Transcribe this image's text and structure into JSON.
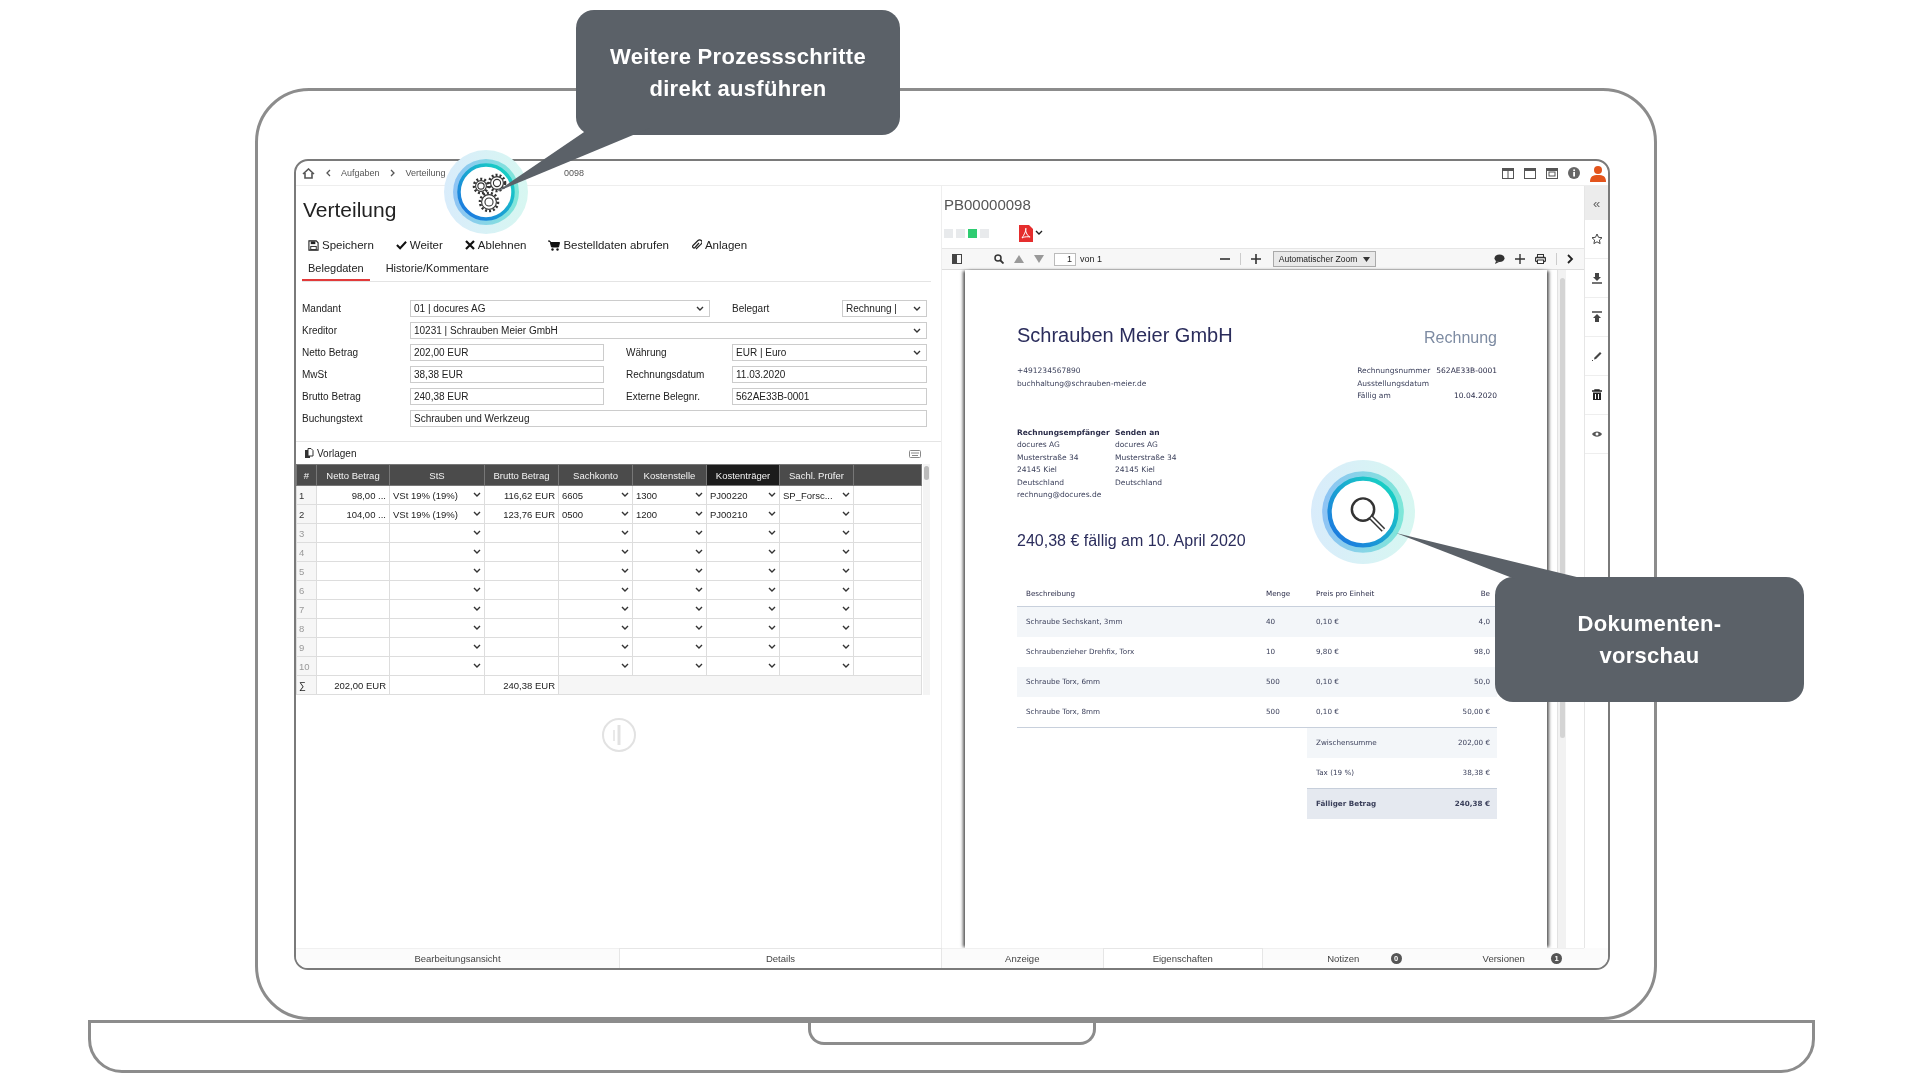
{
  "callouts": [
    {
      "lines": [
        "Weitere Prozessschritte",
        "direkt ausführen"
      ]
    },
    {
      "lines": [
        "Dokumenten-",
        "vorschau"
      ]
    }
  ],
  "breadcrumb": [
    "Aufgaben",
    "Verteilung",
    "0098"
  ],
  "left": {
    "title": "Verteilung",
    "toolbar": [
      "Speichern",
      "Weiter",
      "Ablehnen",
      "Bestelldaten abrufen",
      "Anlagen"
    ],
    "tabs": [
      {
        "label": "Belegdaten",
        "selected": true
      },
      {
        "label": "Historie/Kommentare",
        "selected": false
      }
    ],
    "form": [
      {
        "fields": [
          {
            "label": "Mandant",
            "kind": "select",
            "value": "01 | docures AG"
          },
          {
            "label": "Belegart",
            "kind": "select",
            "value": "Rechnung |"
          }
        ]
      },
      {
        "fields": [
          {
            "label": "Kreditor",
            "kind": "select",
            "value": "10231 | Schrauben Meier GmbH"
          }
        ]
      },
      {
        "fields": [
          {
            "label": "Netto Betrag",
            "kind": "text",
            "value": "202,00 EUR"
          },
          {
            "label": "Währung",
            "kind": "select",
            "value": "EUR | Euro"
          }
        ]
      },
      {
        "fields": [
          {
            "label": "MwSt",
            "kind": "text",
            "value": "38,38 EUR"
          },
          {
            "label": "Rechnungsdatum",
            "kind": "text",
            "value": "11.03.2020"
          }
        ]
      },
      {
        "fields": [
          {
            "label": "Brutto Betrag",
            "kind": "text",
            "value": "240,38 EUR"
          },
          {
            "label": "Externe Belegnr.",
            "kind": "text",
            "value": "562AE33B-0001"
          }
        ]
      },
      {
        "fields": [
          {
            "label": "Buchungstext",
            "kind": "text",
            "value": "Schrauben und Werkzeug"
          }
        ]
      }
    ],
    "templates_label": "Vorlagen",
    "table": {
      "number_header": "#",
      "columns": [
        {
          "label": "Netto Betrag",
          "kind": "text",
          "selected": false
        },
        {
          "label": "StS",
          "kind": "select",
          "selected": false
        },
        {
          "label": "Brutto Betrag",
          "kind": "text",
          "selected": false
        },
        {
          "label": "Sachkonto",
          "kind": "select",
          "selected": false
        },
        {
          "label": "Kostenstelle",
          "kind": "select",
          "selected": false
        },
        {
          "label": "Kostenträger",
          "kind": "select",
          "selected": true
        },
        {
          "label": "Sachl. Prüfer",
          "kind": "select",
          "selected": false
        }
      ],
      "rows": [
        {
          "number": "1",
          "cells": [
            "98,00 ...",
            "VSt 19% (19%)",
            "116,62 EUR",
            "6605",
            "1300",
            "PJ00220",
            "SP_Forsc..."
          ]
        },
        {
          "number": "2",
          "cells": [
            "104,00 ...",
            "VSt 19% (19%)",
            "123,76 EUR",
            "0500",
            "1200",
            "PJ00210"
          ]
        },
        {
          "number": "3"
        },
        {
          "number": "4"
        },
        {
          "number": "5"
        },
        {
          "number": "6"
        },
        {
          "number": "7"
        },
        {
          "number": "8"
        },
        {
          "number": "9"
        },
        {
          "number": "10"
        }
      ],
      "sum": {
        "symbol": "∑",
        "netto": "202,00 EUR",
        "brutto": "240,38 EUR"
      }
    }
  },
  "doc": {
    "document_id": "PB00000098",
    "status_steps": [
      {
        "active": false
      },
      {
        "active": false
      },
      {
        "active": true
      },
      {
        "active": false
      }
    ],
    "page": "1",
    "page_total": "von 1",
    "zoom": "Automatischer Zoom",
    "invoice": {
      "company": "Schrauben Meier GmbH",
      "doc_type": "Rechnung",
      "contact": [
        "+491234567890",
        "buchhaltung@schrauben-meier.de"
      ],
      "meta": [
        {
          "label": "Rechnungsnummer",
          "value": "562AE33B-0001"
        },
        {
          "label": "Ausstellungsdatum"
        },
        {
          "label": "Fällig am",
          "value": "10.04.2020"
        }
      ],
      "addresses": [
        {
          "heading": "Rechnungsempfänger",
          "lines": [
            "docures AG",
            "Musterstraße 34",
            "24145 Kiel",
            "Deutschland",
            "rechnung@docures.de"
          ]
        },
        {
          "heading": "Senden an",
          "lines": [
            "docures AG",
            "Musterstraße 34",
            "24145 Kiel",
            "Deutschland"
          ]
        }
      ],
      "due_line": "240,38 € fällig am 10. April 2020",
      "columns": [
        "Beschreibung",
        "Menge",
        "Preis pro Einheit",
        "Be"
      ],
      "items": [
        {
          "description": "Schraube Sechskant, 3mm",
          "quantity": "40",
          "unit_price": "0,10 €",
          "amount": "4,0"
        },
        {
          "description": "Schraubenzieher Drehfix, Torx",
          "quantity": "10",
          "unit_price": "9,80 €",
          "amount": "98,0"
        },
        {
          "description": "Schraube Torx, 6mm",
          "quantity": "500",
          "unit_price": "0,10 €",
          "amount": "50,0"
        },
        {
          "description": "Schraube Torx, 8mm",
          "quantity": "500",
          "unit_price": "0,10 €",
          "amount": "50,00 €"
        }
      ],
      "totals": [
        {
          "kind": "subtotal",
          "label": "Zwischensumme",
          "value": "202,00 €"
        },
        {
          "kind": "tax",
          "label": "Tax (19 %)",
          "value": "38,38 €"
        },
        {
          "kind": "due",
          "label": "Fälliger Betrag",
          "value": "240,38 €"
        }
      ]
    }
  },
  "sidebar": {
    "collapse": "«"
  },
  "bottom_tabs": {
    "left": [
      {
        "label": "Bearbeitungsansicht",
        "selected": false
      },
      {
        "label": "Details",
        "selected": true
      }
    ],
    "right": [
      {
        "label": "Anzeige",
        "selected": false
      },
      {
        "label": "Eigenschaften",
        "selected": true
      },
      {
        "label": "Notizen",
        "badge": "0",
        "selected": false
      },
      {
        "label": "Versionen",
        "badge": "1",
        "selected": false
      }
    ]
  }
}
